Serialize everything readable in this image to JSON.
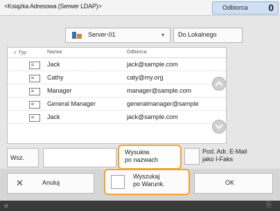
{
  "window": {
    "title": "<Książka Adresowa (Serwer LDAP)>"
  },
  "recipients": {
    "label": "Odbiorca",
    "count": "0"
  },
  "server": {
    "selected": "Server-01",
    "arrow": "▾"
  },
  "local_button": {
    "label": "Do Lokalnego"
  },
  "list": {
    "header": {
      "type": "✓ Typ",
      "name": "Nazwa",
      "recipient": "Odbiorca"
    },
    "rows": [
      {
        "name": "Jack",
        "recipient": "jack@sample.com"
      },
      {
        "name": "Cathy",
        "recipient": "caty@my.org"
      },
      {
        "name": "Manager",
        "recipient": "manager@sample.com"
      },
      {
        "name": "General Manager",
        "recipient": "generalmanager@sample"
      },
      {
        "name": "Jack",
        "recipient": "jack@sample.com"
      }
    ]
  },
  "controls": {
    "search_label": "Wsz.",
    "sort_label": "Wysukiw.\npo nazwach",
    "fax_label": "Pod. Adr. E-Mail\njako I-Faks"
  },
  "footer": {
    "cancel_icon": "✕",
    "cancel_label": "Anuluj",
    "conditional_label": "Wyszukaj\npo Warunk.",
    "ok_label": "OK"
  },
  "status": {
    "left": "⌀",
    "right": "⎘"
  }
}
